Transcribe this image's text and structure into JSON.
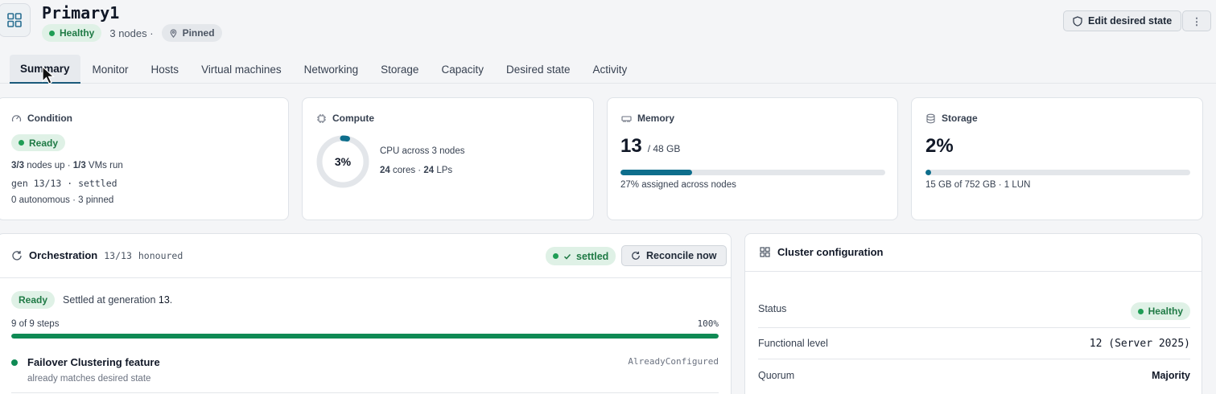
{
  "header": {
    "title": "Primary1",
    "status": "Healthy",
    "nodes": "3 nodes ·",
    "pinned": "Pinned",
    "edit_label": "Edit desired state",
    "more_label": "⋮"
  },
  "tabs": [
    {
      "label": "Summary",
      "active": true
    },
    {
      "label": "Monitor"
    },
    {
      "label": "Hosts"
    },
    {
      "label": "Virtual machines"
    },
    {
      "label": "Networking"
    },
    {
      "label": "Storage"
    },
    {
      "label": "Capacity"
    },
    {
      "label": "Desired state"
    },
    {
      "label": "Activity"
    }
  ],
  "condition": {
    "title": "Condition",
    "badge": "Ready",
    "nodes_up_a": "3/3",
    "nodes_up_b": " nodes up · ",
    "vms_a": "1/3",
    "vms_b": " VMs run",
    "gen": "gen 13/13 · settled",
    "footer": "0 autonomous · 3 pinned"
  },
  "compute": {
    "title": "Compute",
    "percent_label": "3%",
    "percent": 3,
    "desc": "CPU across 3 nodes",
    "cores": "24",
    "cores_unit": " cores · ",
    "lps": "24",
    "lps_unit": " LPs"
  },
  "memory": {
    "title": "Memory",
    "value": "13",
    "total": "/ 48 GB",
    "percent": 27,
    "footer": "27% assigned across nodes"
  },
  "storage": {
    "title": "Storage",
    "value": "2%",
    "percent": 2,
    "footer": "15 GB of 752 GB · 1 LUN"
  },
  "orchestration": {
    "title": "Orchestration",
    "honoured_count": "13/13",
    "honoured": "honoured",
    "settled": "settled",
    "reconcile": "Reconcile now",
    "ready": "Ready",
    "settled_text": "Settled at generation ",
    "generation": "13",
    "period": ".",
    "steps": "9 of 9 steps",
    "progress_label": "100%",
    "progress": 100,
    "step_title": "Failover Clustering feature",
    "step_sub": "already matches desired state",
    "step_state": "AlreadyConfigured"
  },
  "cluster": {
    "title": "Cluster configuration",
    "rows": [
      {
        "label": "Status",
        "value": "Healthy"
      },
      {
        "label": "Functional level",
        "value": "12 (Server 2025)"
      },
      {
        "label": "Quorum",
        "value": "Majority"
      }
    ]
  },
  "colors": {
    "accent": "#0e6e8c",
    "success": "#1f9d55",
    "progress": "#0f8a54"
  }
}
